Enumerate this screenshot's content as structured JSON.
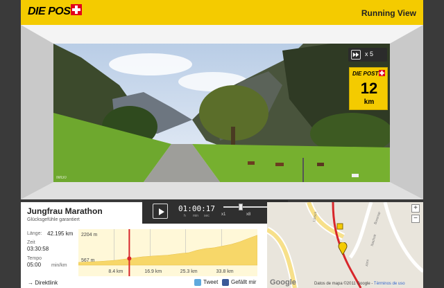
{
  "header": {
    "logo_text": "DIE POST",
    "view_title": "Running View",
    "brand_color": "#f4cb00"
  },
  "video": {
    "watermark": "IMG0"
  },
  "speed_badge": {
    "icon": "fast-forward-icon",
    "label": "x 5"
  },
  "km_badge": {
    "logo_text": "DIE POST",
    "value": "12",
    "unit": "km"
  },
  "run": {
    "title": "Jungfrau Marathon",
    "subtitle": "Glücksgefühle garantiert",
    "length_label": "Länge:",
    "length_value": "42.195 km",
    "time_label": "Zeit",
    "time_value": "03:30:58",
    "tempo_label": "Tempo",
    "tempo_value": "05:00",
    "tempo_unit": "min/km"
  },
  "player": {
    "play_icon": "play-icon",
    "time": "01:00:17",
    "unit_h": "h",
    "unit_min": "min",
    "unit_sec": "sec",
    "speed_ticks": [
      "x1",
      "x8",
      "x25"
    ],
    "speed_position_fraction": 0.3
  },
  "links": {
    "direktlink": "Direktlink",
    "tweet": "Tweet",
    "facebook": "Gefällt mir"
  },
  "map": {
    "zoom_in": "+",
    "zoom_out": "−",
    "google": "Google",
    "credit": "Datos de mapa ©2011 Google - ",
    "credit_link": "Términos de uso",
    "streets": [
      "Lütsch",
      "Burenstr",
      "Ibachstr",
      "Almi"
    ]
  },
  "chart_data": {
    "type": "area",
    "title": "",
    "xlabel": "",
    "ylabel": "",
    "y_top_label": "2204 m",
    "y_bottom_label": "567 m",
    "x_tick_labels": [
      "8.4 km",
      "16.9 km",
      "25.3 km",
      "33.8 km"
    ],
    "x_ticks": [
      8.4,
      16.9,
      25.3,
      33.8
    ],
    "xlim": [
      0,
      42.195
    ],
    "ylim": [
      400,
      2400
    ],
    "current_km": 12,
    "x": [
      0,
      3,
      6,
      9,
      12,
      15,
      18,
      21,
      24,
      26,
      28,
      30,
      32,
      34,
      36,
      38,
      40,
      42.195
    ],
    "y": [
      567,
      600,
      640,
      700,
      800,
      900,
      960,
      1000,
      1100,
      1150,
      1300,
      1400,
      1450,
      1550,
      1650,
      1800,
      2000,
      2204
    ]
  }
}
